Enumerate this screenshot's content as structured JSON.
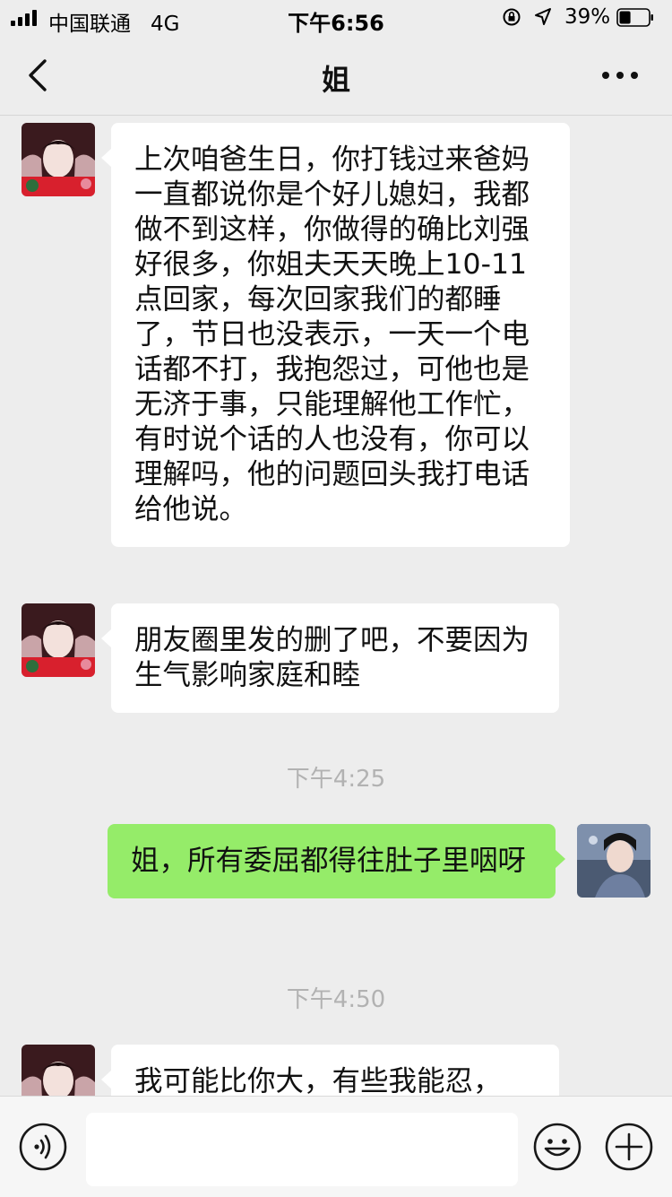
{
  "status_bar": {
    "carrier": "中国联通",
    "network": "4G",
    "time": "下午6:56",
    "battery_percent": "39%",
    "battery_level": 0.39
  },
  "nav": {
    "title": "姐",
    "back_icon": "chevron-left-icon",
    "more_icon": "more-dots-icon"
  },
  "messages": [
    {
      "side": "left",
      "text": "上次咱爸生日，你打钱过来爸妈一直都说你是个好儿媳妇，我都做不到这样，你做得的确比刘强好很多，你姐夫天天晚上10-11点回家，每次回家我们的都睡了，节日也没表示，一天一个电话都不打，我抱怨过，可他也是无济于事，只能理解他工作忙，有时说个话的人也没有，你可以理解吗，他的问题回头我打电话给他说。"
    },
    {
      "side": "left",
      "text": "朋友圈里发的删了吧，不要因为生气影响家庭和睦"
    },
    {
      "type": "time",
      "text": "下午4:25"
    },
    {
      "side": "right",
      "text": "姐，所有委屈都得往肚子里咽呀"
    },
    {
      "type": "time",
      "text": "下午4:50"
    },
    {
      "side": "left",
      "text": "我可能比你大，有些我能忍，"
    }
  ],
  "input_bar": {
    "voice_icon": "voice-icon",
    "emoji_icon": "emoji-icon",
    "plus_icon": "plus-icon",
    "input_value": ""
  },
  "colors": {
    "background": "#ededed",
    "sent_bubble": "#95ec69",
    "received_bubble": "#ffffff",
    "timestamp": "#b2b2b2"
  }
}
